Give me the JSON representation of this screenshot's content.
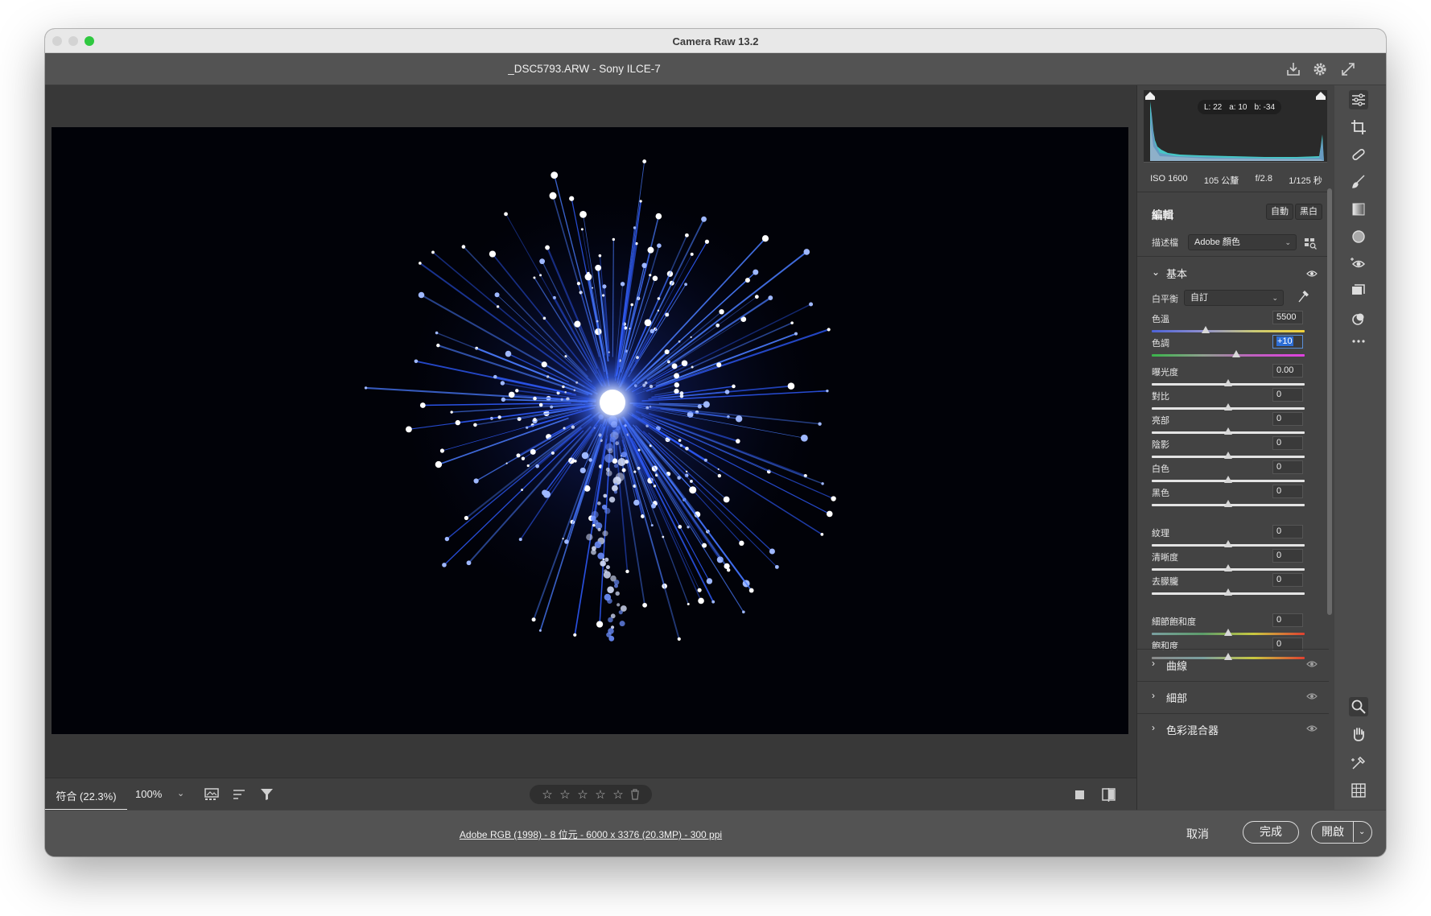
{
  "window": {
    "title": "Camera Raw 13.2"
  },
  "document": {
    "title": "_DSC5793.ARW  -  Sony ILCE-7"
  },
  "histogram": {
    "lab": {
      "l": "L: 22",
      "a": "a: 10",
      "b": "b: -34"
    }
  },
  "camera_info": {
    "iso": "ISO 1600",
    "focal": "105 公釐",
    "aperture": "f/2.8",
    "shutter": "1/125 秒"
  },
  "edit": {
    "title": "編輯",
    "auto_label": "自動",
    "bw_label": "黑白",
    "profile_label": "描述檔",
    "profile_value": "Adobe 顏色"
  },
  "basic": {
    "title": "基本",
    "wb_label": "白平衡",
    "wb_value": "自訂",
    "sliders": [
      {
        "label": "色溫",
        "value": "5500",
        "pos": 0.35
      },
      {
        "label": "色調",
        "value": "+10",
        "pos": 0.55
      },
      {
        "label": "曝光度",
        "value": "0.00",
        "pos": 0.5
      },
      {
        "label": "對比",
        "value": "0",
        "pos": 0.5
      },
      {
        "label": "亮部",
        "value": "0",
        "pos": 0.5
      },
      {
        "label": "陰影",
        "value": "0",
        "pos": 0.5
      },
      {
        "label": "白色",
        "value": "0",
        "pos": 0.5
      },
      {
        "label": "黑色",
        "value": "0",
        "pos": 0.5
      },
      {
        "label": "紋理",
        "value": "0",
        "pos": 0.5
      },
      {
        "label": "清晰度",
        "value": "0",
        "pos": 0.5
      },
      {
        "label": "去朦朧",
        "value": "0",
        "pos": 0.5
      },
      {
        "label": "細節飽和度",
        "value": "0",
        "pos": 0.5
      },
      {
        "label": "飽和度",
        "value": "0",
        "pos": 0.5
      }
    ]
  },
  "panels": [
    {
      "label": "曲線"
    },
    {
      "label": "細部"
    },
    {
      "label": "色彩混合器"
    }
  ],
  "filmstrip": {
    "fit_label": "符合 (22.3%)",
    "zoom_label": "100%"
  },
  "bottom": {
    "meta": "Adobe RGB (1998) - 8 位元 - 6000 x 3376 (20.3MP) - 300 ppi",
    "cancel": "取消",
    "done": "完成",
    "open": "開啟"
  },
  "icons": {
    "top": [
      "save-icon",
      "gear-icon",
      "fullscreen-icon"
    ],
    "tools": [
      "edit-sliders-icon",
      "crop-icon",
      "healing-icon",
      "brush-icon",
      "linear-gradient-icon",
      "radial-filter-icon",
      "red-eye-icon",
      "snapshots-icon",
      "presets-icon",
      "more-icon",
      "zoom-icon",
      "hand-icon",
      "color-sampler-icon",
      "grid-icon"
    ]
  },
  "colors": {
    "accent": "#2d6ed6",
    "firework": "#3a6bff"
  }
}
